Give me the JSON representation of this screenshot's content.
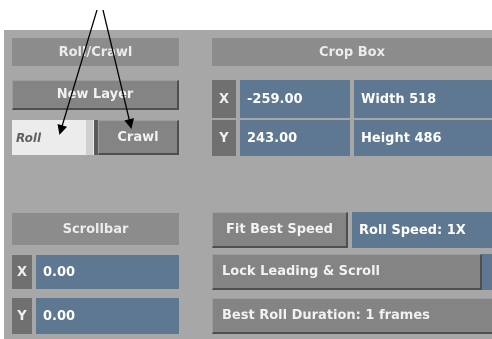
{
  "roll_crawl": {
    "header": "Roll/Crawl",
    "new_layer_label": "New Layer",
    "mode_roll_label": "Roll",
    "mode_crawl_label": "Crawl",
    "active_mode": "Roll"
  },
  "crop_box": {
    "header": "Crop Box",
    "x_axis": "X",
    "x_value": "-259.00",
    "width_label": "Width 518",
    "y_axis": "Y",
    "y_value": "243.00",
    "height_label": "Height 486"
  },
  "scrollbar": {
    "header": "Scrollbar",
    "x_axis": "X",
    "x_value": "0.00",
    "y_axis": "Y",
    "y_value": "0.00"
  },
  "speed": {
    "fit_best_speed_label": "Fit Best Speed",
    "roll_speed_label": "Roll Speed: 1X",
    "lock_leading_label": "Lock Leading & Scroll",
    "best_roll_duration_label": "Best Roll Duration: 1 frames"
  },
  "colors": {
    "panel_bg": "#a7a7a7",
    "header_bg": "#8c8c8c",
    "button_bg": "#848484",
    "field_bg": "#5f7891",
    "active_toggle_bg": "#ececec"
  }
}
